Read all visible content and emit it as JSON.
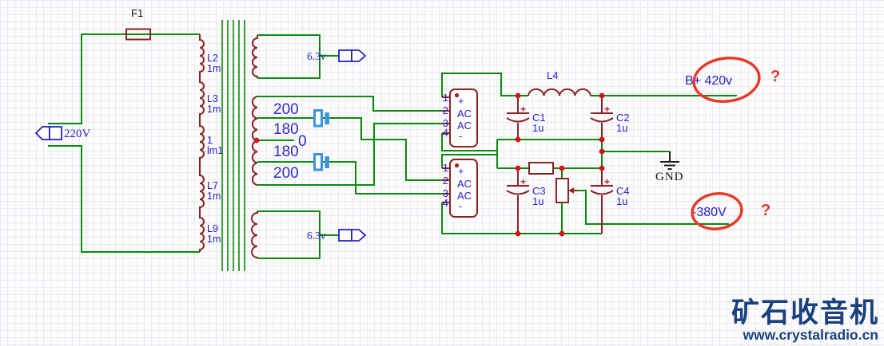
{
  "schematic": {
    "fuse_ref": "F1",
    "mains_label": "220V",
    "primary_windings": [
      {
        "ref": "L2",
        "val": "1m"
      },
      {
        "ref": "L3",
        "val": "1m"
      },
      {
        "ref": "1",
        "val": "lm1"
      },
      {
        "ref": "L7",
        "val": "1m"
      },
      {
        "ref": "L9",
        "val": "1m"
      }
    ],
    "heater_top_label": "6.3v",
    "heater_bottom_label": "6.3v",
    "hv_taps": [
      "200",
      "180",
      "0",
      "180",
      "200"
    ],
    "bridges": [
      {
        "pins": [
          "1",
          "2",
          "3",
          "4"
        ],
        "marks": [
          "+",
          "AC",
          "AC",
          "-"
        ]
      },
      {
        "pins": [
          "1",
          "2",
          "3",
          "4"
        ],
        "marks": [
          "+",
          "AC",
          "AC",
          "-"
        ]
      }
    ],
    "choke_ref": "L4",
    "caps": [
      {
        "ref": "C1",
        "val": "1u",
        "pol": "+"
      },
      {
        "ref": "C2",
        "val": "1u",
        "pol": "+"
      },
      {
        "ref": "C3",
        "val": "1u",
        "pol": "+"
      },
      {
        "ref": "C4",
        "val": "1u",
        "pol": "+"
      }
    ],
    "gnd_label": "GND",
    "output_pos": {
      "label": "B+ 420v",
      "question": "?"
    },
    "output_neg": {
      "label": "-380V",
      "question": "?"
    }
  },
  "watermark": {
    "title": "矿石收音机",
    "url": "www.crystalradio.cn"
  },
  "colors": {
    "wire": "#0c8a0c",
    "component": "#8b2121",
    "label_blue": "#2323c8",
    "junction": "#d41414",
    "annotation": "#e8392a",
    "watermark": "#19407f"
  }
}
